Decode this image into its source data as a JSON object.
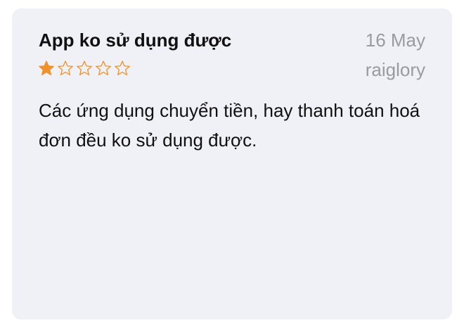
{
  "review": {
    "title": "App ko sử dụng được",
    "date": "16 May",
    "author": "raiglory",
    "rating": 1,
    "max_rating": 5,
    "body": "Các ứng dụng chuyển tiền, hay thanh toán hoá đơn đều ko sử dụng được."
  },
  "colors": {
    "star": "#f0912b",
    "card_background": "#f0f0f7",
    "secondary_text": "#9a9aa0"
  }
}
